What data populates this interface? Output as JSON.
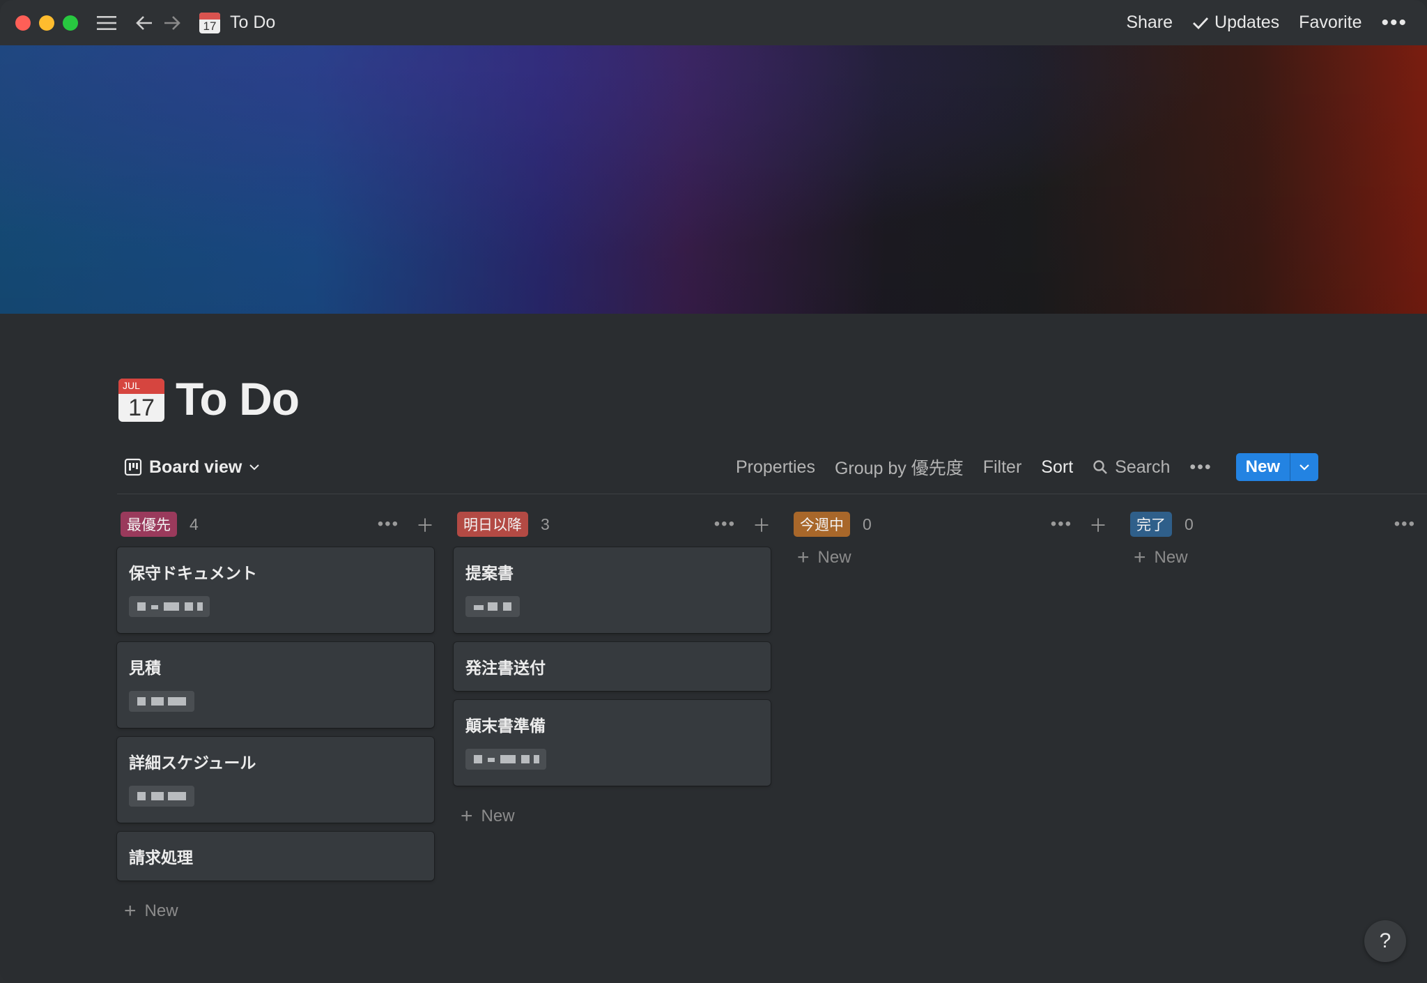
{
  "titlebar": {
    "title": "To Do",
    "icon": "calendar-icon",
    "calendar_day": "17",
    "share_label": "Share",
    "updates_label": "Updates",
    "favorite_label": "Favorite"
  },
  "page": {
    "title": "To Do",
    "icon_month": "JUL",
    "icon_day": "17"
  },
  "toolbar": {
    "view_label": "Board view",
    "properties_label": "Properties",
    "group_by_label": "Group by 優先度",
    "filter_label": "Filter",
    "sort_label": "Sort",
    "search_label": "Search",
    "new_label": "New"
  },
  "columns": [
    {
      "tag": "最優先",
      "color": "#9a3a5c",
      "count": "4",
      "cards": [
        {
          "title": "保守ドキュメント",
          "has_pill": true
        },
        {
          "title": "見積",
          "has_pill": true
        },
        {
          "title": "詳細スケジュール",
          "has_pill": true
        },
        {
          "title": "請求処理",
          "has_pill": false
        }
      ],
      "new_label": "New"
    },
    {
      "tag": "明日以降",
      "color": "#b34a44",
      "count": "3",
      "cards": [
        {
          "title": "提案書",
          "has_pill": true
        },
        {
          "title": "発注書送付",
          "has_pill": false
        },
        {
          "title": "顛末書準備",
          "has_pill": true
        }
      ],
      "new_label": "New"
    },
    {
      "tag": "今週中",
      "color": "#a8672a",
      "count": "0",
      "cards": [],
      "new_label": "New"
    },
    {
      "tag": "完了",
      "color": "#2f5f8a",
      "count": "0",
      "cards": [],
      "new_label": "New"
    }
  ],
  "help_label": "?"
}
